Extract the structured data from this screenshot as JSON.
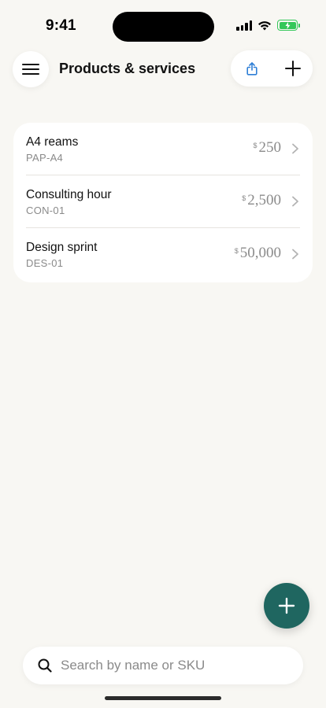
{
  "status_bar": {
    "time": "9:41"
  },
  "header": {
    "title": "Products & services"
  },
  "products": [
    {
      "name": "A4 reams",
      "sku": "PAP-A4",
      "currency": "$",
      "price": "250"
    },
    {
      "name": "Consulting hour",
      "sku": "CON-01",
      "currency": "$",
      "price": "2,500"
    },
    {
      "name": "Design sprint",
      "sku": "DES-01",
      "currency": "$",
      "price": "50,000"
    }
  ],
  "search": {
    "placeholder": "Search by name or SKU",
    "value": ""
  },
  "icons": {
    "menu": "menu-icon",
    "share": "share-icon",
    "add": "plus-icon",
    "chevron": "chevron-right-icon",
    "search": "search-icon"
  },
  "colors": {
    "background": "#f8f7f3",
    "card": "#ffffff",
    "accent": "#1f6660",
    "share_icon": "#2f7fd6",
    "battery": "#34c759"
  }
}
